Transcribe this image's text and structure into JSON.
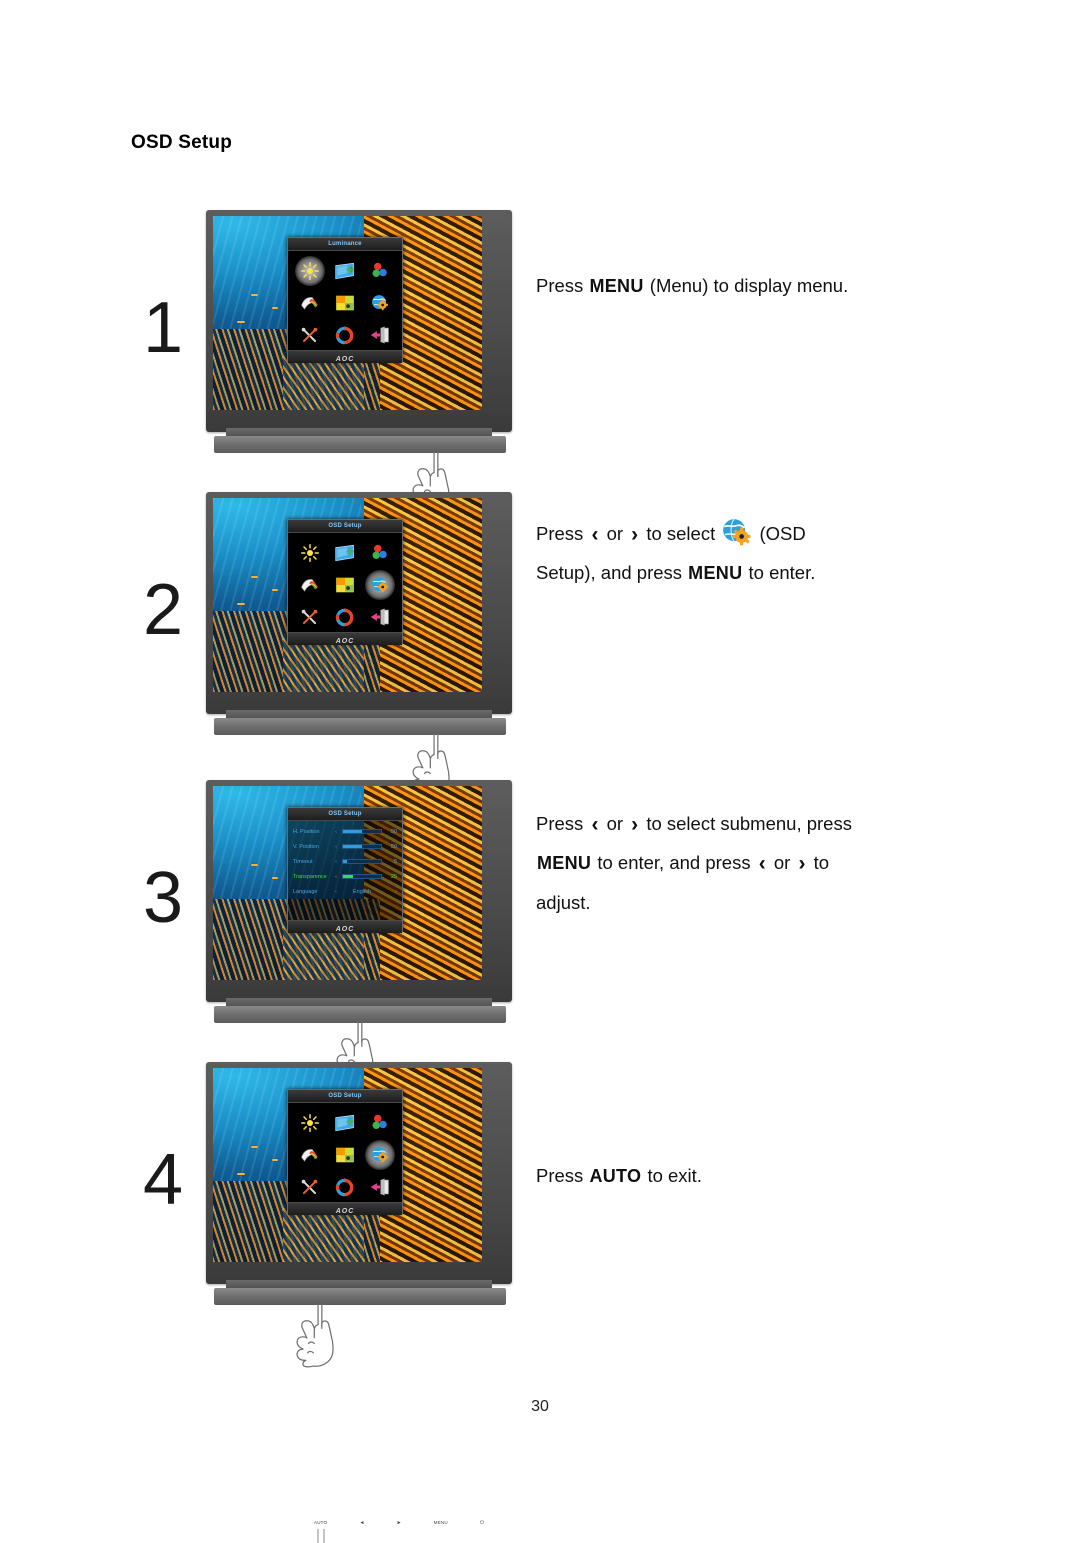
{
  "document": {
    "heading": "OSD Setup",
    "page_number": "30"
  },
  "steps": [
    {
      "number": "1",
      "osd": {
        "title": "Luminance",
        "brand": "AOC",
        "selected_index": 0
      },
      "text": {
        "line1_a": "Press",
        "line1_key": "MENU",
        "line1_b": "(Menu) to display menu."
      },
      "hand_target": "menu-button"
    },
    {
      "number": "2",
      "osd": {
        "title": "OSD Setup",
        "brand": "AOC",
        "selected_index": 5
      },
      "text": {
        "line1_a": "Press",
        "left_arrow": "‹",
        "or": "or",
        "right_arrow": "›",
        "line1_b": "to select",
        "line1_c": "(OSD",
        "line2_a": "Setup), and press",
        "line2_key": "MENU",
        "line2_b": "to enter."
      },
      "hand_target": "menu-button"
    },
    {
      "number": "3",
      "osd": {
        "title": "OSD Setup",
        "brand": "AOC",
        "rows": [
          {
            "label": "H. Position",
            "left": "‹",
            "value": "50",
            "fill": 50,
            "highlight": false
          },
          {
            "label": "V. Position",
            "left": "‹",
            "value": "50",
            "fill": 50,
            "highlight": false
          },
          {
            "label": "Timeout",
            "left": "‹",
            "value": "5",
            "fill": 10,
            "highlight": false
          },
          {
            "label": "Transparence",
            "left": "‹",
            "value": "25",
            "fill": 25,
            "highlight": true
          },
          {
            "label": "Language",
            "left": "‹",
            "option": "English",
            "right": "›",
            "highlight": false
          }
        ]
      },
      "text": {
        "line1_a": "Press",
        "left_arrow": "‹",
        "or": "or",
        "right_arrow": "›",
        "line1_b": "to select submenu, press",
        "line2_key": "MENU",
        "line2_a": "to enter, and press",
        "line2_b": "to",
        "line3": "adjust."
      },
      "hand_target": "menu-button"
    },
    {
      "number": "4",
      "osd": {
        "title": "OSD Setup",
        "brand": "AOC",
        "selected_index": 5
      },
      "text": {
        "line1_a": "Press",
        "line1_key": "AUTO",
        "line1_b": "to exit."
      },
      "hand_target": "auto-button"
    }
  ],
  "monitor_buttons": {
    "auto": "AUTO",
    "left": "◄",
    "right": "►",
    "menu": "MENU",
    "power": "⏻"
  },
  "osd_icons": [
    "luminance-icon",
    "image-setup-icon",
    "color-setup-icon",
    "picture-boost-icon",
    "extra-icon",
    "osd-setup-icon",
    "tools-icon",
    "reset-icon",
    "exit-icon"
  ],
  "colors": {
    "accent_blue": "#2f9ee0",
    "highlight_green": "#37e03a",
    "osd_title_text": "#7fc7ff",
    "bezel": "#4a4a4a",
    "gear_orange": "#f5a21e"
  }
}
